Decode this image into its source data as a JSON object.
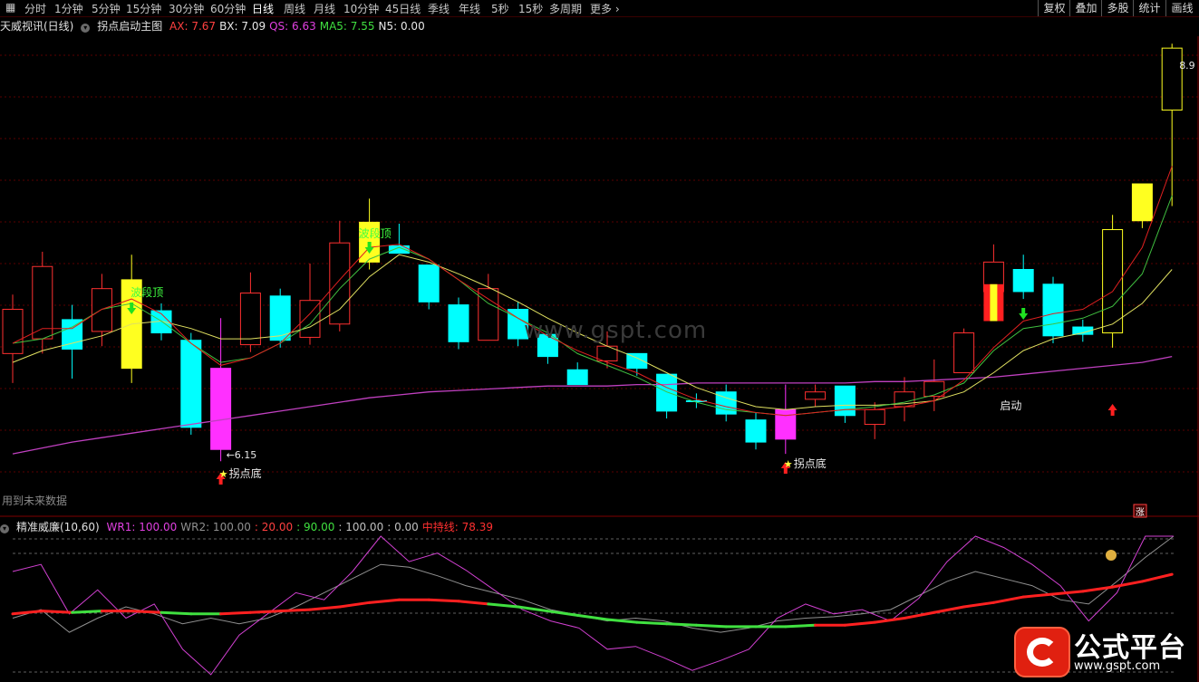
{
  "toolbar": {
    "periods": [
      "分时",
      "1分钟",
      "5分钟",
      "15分钟",
      "30分钟",
      "60分钟",
      "日线",
      "周线",
      "月线",
      "10分钟",
      "45日线",
      "季线",
      "年线",
      "5秒",
      "15秒",
      "多周期",
      "更多"
    ],
    "active": "日线",
    "right_buttons": [
      "复权",
      "叠加",
      "多股",
      "统计",
      "画线"
    ]
  },
  "main": {
    "stock_name": "天威视讯(日线)",
    "formula": "拐点启动主图",
    "values": [
      {
        "label": "AX: 7.67",
        "color": "#ff4040"
      },
      {
        "label": "BX: 7.09",
        "color": "#e8e8e8"
      },
      {
        "label": "QS: 6.63",
        "color": "#e040e0"
      },
      {
        "label": "MA5: 7.55",
        "color": "#40e040"
      },
      {
        "label": "N5: 0.00",
        "color": "#e8e8e8"
      }
    ],
    "price_high_label": "8.9",
    "low_label": "←6.15",
    "annotations": {
      "wave_top": "波段顶",
      "turn_bottom": "拐点底",
      "start": "启动",
      "star": "★"
    },
    "future_note": "用到未来数据",
    "watermark": "www.gspt.com",
    "rise_badge": "涨"
  },
  "indicator": {
    "name": "精准威廉(10,60)",
    "values": [
      {
        "label": "WR1: 100.00",
        "color": "#e040e0"
      },
      {
        "label": "WR2: 100.00",
        "color": "#909090"
      },
      {
        "label": ": 20.00",
        "color": "#ff4040"
      },
      {
        "label": ": 90.00",
        "color": "#40e040"
      },
      {
        "label": ": 100.00",
        "color": "#c0c0c0"
      },
      {
        "label": ": 0.00",
        "color": "#c0c0c0"
      },
      {
        "label": "中持线: 78.39",
        "color": "#ff3030"
      }
    ]
  },
  "colors": {
    "up": "#ff3030",
    "down": "#00ffff",
    "ax": "#e02020",
    "bx": "#e0e060",
    "qs": "#c040c0",
    "ma5": "#40c040",
    "wave_yellow": "#ffff20",
    "magenta": "#ff30ff",
    "grid": "#5a0000"
  },
  "logo": {
    "name": "公式平台",
    "url": "www.gspt.com"
  },
  "chart_data": {
    "type": "candlestick",
    "main_range": [
      5.9,
      9.0
    ],
    "indicator_range": [
      0,
      100
    ],
    "candles": [
      {
        "o": 6.88,
        "h": 7.28,
        "l": 6.68,
        "c": 7.18,
        "s": "up"
      },
      {
        "o": 6.98,
        "h": 7.57,
        "l": 6.88,
        "c": 7.47,
        "s": "up"
      },
      {
        "o": 7.11,
        "h": 7.21,
        "l": 6.71,
        "c": 6.91,
        "s": "down"
      },
      {
        "o": 7.03,
        "h": 7.42,
        "l": 6.93,
        "c": 7.32,
        "s": "up"
      },
      {
        "o": 7.38,
        "h": 7.55,
        "l": 6.68,
        "c": 6.78,
        "s": "yellow"
      },
      {
        "o": 7.17,
        "h": 7.22,
        "l": 6.97,
        "c": 7.02,
        "s": "down"
      },
      {
        "o": 6.97,
        "h": 7.02,
        "l": 6.33,
        "c": 6.38,
        "s": "down"
      },
      {
        "o": 6.78,
        "h": 7.12,
        "l": 6.15,
        "c": 6.23,
        "s": "magenta"
      },
      {
        "o": 6.94,
        "h": 7.43,
        "l": 6.89,
        "c": 7.29,
        "s": "up"
      },
      {
        "o": 7.27,
        "h": 7.32,
        "l": 6.92,
        "c": 6.97,
        "s": "down"
      },
      {
        "o": 6.99,
        "h": 7.49,
        "l": 6.94,
        "c": 7.24,
        "s": "up"
      },
      {
        "o": 7.08,
        "h": 7.78,
        "l": 7.03,
        "c": 7.63,
        "s": "up"
      },
      {
        "o": 7.77,
        "h": 7.93,
        "l": 7.45,
        "c": 7.5,
        "s": "yellow"
      },
      {
        "o": 7.61,
        "h": 7.76,
        "l": 7.56,
        "c": 7.56,
        "s": "down"
      },
      {
        "o": 7.48,
        "h": 7.48,
        "l": 7.18,
        "c": 7.23,
        "s": "down"
      },
      {
        "o": 7.21,
        "h": 7.26,
        "l": 6.91,
        "c": 6.96,
        "s": "down"
      },
      {
        "o": 6.97,
        "h": 7.42,
        "l": 6.97,
        "c": 7.32,
        "s": "up"
      },
      {
        "o": 7.18,
        "h": 7.23,
        "l": 6.93,
        "c": 6.98,
        "s": "down"
      },
      {
        "o": 7.01,
        "h": 7.01,
        "l": 6.81,
        "c": 6.86,
        "s": "down"
      },
      {
        "o": 6.77,
        "h": 6.82,
        "l": 6.67,
        "c": 6.67,
        "s": "down"
      },
      {
        "o": 6.83,
        "h": 7.03,
        "l": 6.78,
        "c": 6.93,
        "s": "up"
      },
      {
        "o": 6.88,
        "h": 6.88,
        "l": 6.73,
        "c": 6.78,
        "s": "down"
      },
      {
        "o": 6.74,
        "h": 6.74,
        "l": 6.44,
        "c": 6.49,
        "s": "down"
      },
      {
        "o": 6.56,
        "h": 6.61,
        "l": 6.51,
        "c": 6.56,
        "s": "down"
      },
      {
        "o": 6.62,
        "h": 6.67,
        "l": 6.42,
        "c": 6.47,
        "s": "down"
      },
      {
        "o": 6.43,
        "h": 6.48,
        "l": 6.23,
        "c": 6.28,
        "s": "down"
      },
      {
        "o": 6.5,
        "h": 6.67,
        "l": 6.2,
        "c": 6.3,
        "s": "magenta"
      },
      {
        "o": 6.57,
        "h": 6.67,
        "l": 6.52,
        "c": 6.62,
        "s": "up"
      },
      {
        "o": 6.66,
        "h": 6.66,
        "l": 6.41,
        "c": 6.46,
        "s": "down"
      },
      {
        "o": 6.4,
        "h": 6.55,
        "l": 6.3,
        "c": 6.5,
        "s": "up"
      },
      {
        "o": 6.52,
        "h": 6.72,
        "l": 6.42,
        "c": 6.62,
        "s": "up"
      },
      {
        "o": 6.59,
        "h": 6.84,
        "l": 6.49,
        "c": 6.69,
        "s": "up"
      },
      {
        "o": 6.75,
        "h": 7.05,
        "l": 6.75,
        "c": 7.02,
        "s": "up"
      },
      {
        "o": 7.3,
        "h": 7.62,
        "l": 7.1,
        "c": 7.5,
        "s": "up"
      },
      {
        "o": 7.45,
        "h": 7.55,
        "l": 7.25,
        "c": 7.3,
        "s": "down"
      },
      {
        "o": 7.35,
        "h": 7.4,
        "l": 6.95,
        "c": 7.0,
        "s": "down"
      },
      {
        "o": 7.06,
        "h": 7.11,
        "l": 6.96,
        "c": 7.01,
        "s": "down"
      },
      {
        "o": 7.02,
        "h": 7.82,
        "l": 6.92,
        "c": 7.72,
        "s": "yellow"
      },
      {
        "o": 8.03,
        "h": 8.03,
        "l": 7.73,
        "c": 7.78,
        "s": "yellow"
      },
      {
        "o": 8.53,
        "h": 8.98,
        "l": 7.88,
        "c": 8.95,
        "s": "yellow"
      }
    ],
    "start_box_index": 33,
    "ax": [
      6.95,
      7.05,
      7.05,
      7.18,
      7.25,
      7.15,
      6.95,
      6.8,
      6.85,
      6.95,
      7.15,
      7.38,
      7.6,
      7.62,
      7.52,
      7.38,
      7.25,
      7.12,
      7.0,
      6.9,
      6.82,
      6.75,
      6.65,
      6.57,
      6.52,
      6.48,
      6.46,
      6.48,
      6.5,
      6.5,
      6.52,
      6.56,
      6.7,
      6.92,
      7.1,
      7.15,
      7.18,
      7.3,
      7.6,
      8.15
    ],
    "bx": [
      6.82,
      6.9,
      6.95,
      7.0,
      7.08,
      7.1,
      7.05,
      6.98,
      6.98,
      7.0,
      7.06,
      7.18,
      7.4,
      7.55,
      7.5,
      7.42,
      7.33,
      7.23,
      7.12,
      7.02,
      6.93,
      6.85,
      6.75,
      6.65,
      6.58,
      6.52,
      6.5,
      6.52,
      6.53,
      6.53,
      6.54,
      6.56,
      6.62,
      6.75,
      6.9,
      6.98,
      7.02,
      7.08,
      7.22,
      7.45
    ],
    "ma5": [
      6.95,
      6.98,
      7.06,
      7.18,
      7.22,
      7.1,
      6.95,
      6.82,
      6.85,
      6.95,
      7.08,
      7.32,
      7.52,
      7.6,
      7.52,
      7.38,
      7.22,
      7.12,
      7.02,
      6.88,
      6.8,
      6.72,
      6.62,
      6.55,
      6.5,
      6.48,
      6.46,
      6.48,
      6.5,
      6.52,
      6.55,
      6.6,
      6.68,
      6.9,
      7.05,
      7.08,
      7.12,
      7.2,
      7.42,
      7.95
    ],
    "qs": [
      6.2,
      6.24,
      6.28,
      6.31,
      6.34,
      6.37,
      6.4,
      6.43,
      6.46,
      6.49,
      6.52,
      6.55,
      6.58,
      6.6,
      6.62,
      6.63,
      6.64,
      6.65,
      6.66,
      6.66,
      6.66,
      6.67,
      6.67,
      6.68,
      6.68,
      6.68,
      6.68,
      6.68,
      6.68,
      6.69,
      6.69,
      6.7,
      6.71,
      6.72,
      6.74,
      6.76,
      6.78,
      6.8,
      6.82,
      6.86
    ],
    "wr1": [
      75,
      80,
      45,
      62,
      42,
      52,
      20,
      2,
      30,
      45,
      60,
      55,
      75,
      100,
      82,
      88,
      76,
      62,
      48,
      40,
      35,
      20,
      22,
      14,
      5,
      12,
      20,
      42,
      52,
      45,
      48,
      40,
      56,
      82,
      100,
      92,
      80,
      65,
      40,
      60,
      100,
      100
    ],
    "wr2": [
      42,
      48,
      32,
      42,
      50,
      45,
      38,
      42,
      38,
      42,
      50,
      60,
      70,
      80,
      78,
      72,
      65,
      60,
      55,
      48,
      44,
      40,
      42,
      40,
      35,
      32,
      35,
      40,
      42,
      43,
      45,
      48,
      58,
      68,
      75,
      70,
      65,
      55,
      52,
      68,
      85,
      100
    ],
    "mid": [
      45,
      47,
      46,
      47,
      47,
      46,
      45,
      45,
      46,
      47,
      48,
      50,
      53,
      55,
      55,
      54,
      52,
      50,
      47,
      44,
      41,
      39,
      38,
      37,
      36,
      36,
      36,
      37,
      37,
      39,
      42,
      46,
      50,
      53,
      57,
      59,
      61,
      64,
      68,
      73
    ],
    "mid_green_segments": [
      [
        2,
        2
      ],
      [
        5,
        6
      ],
      [
        16,
        26
      ]
    ]
  }
}
